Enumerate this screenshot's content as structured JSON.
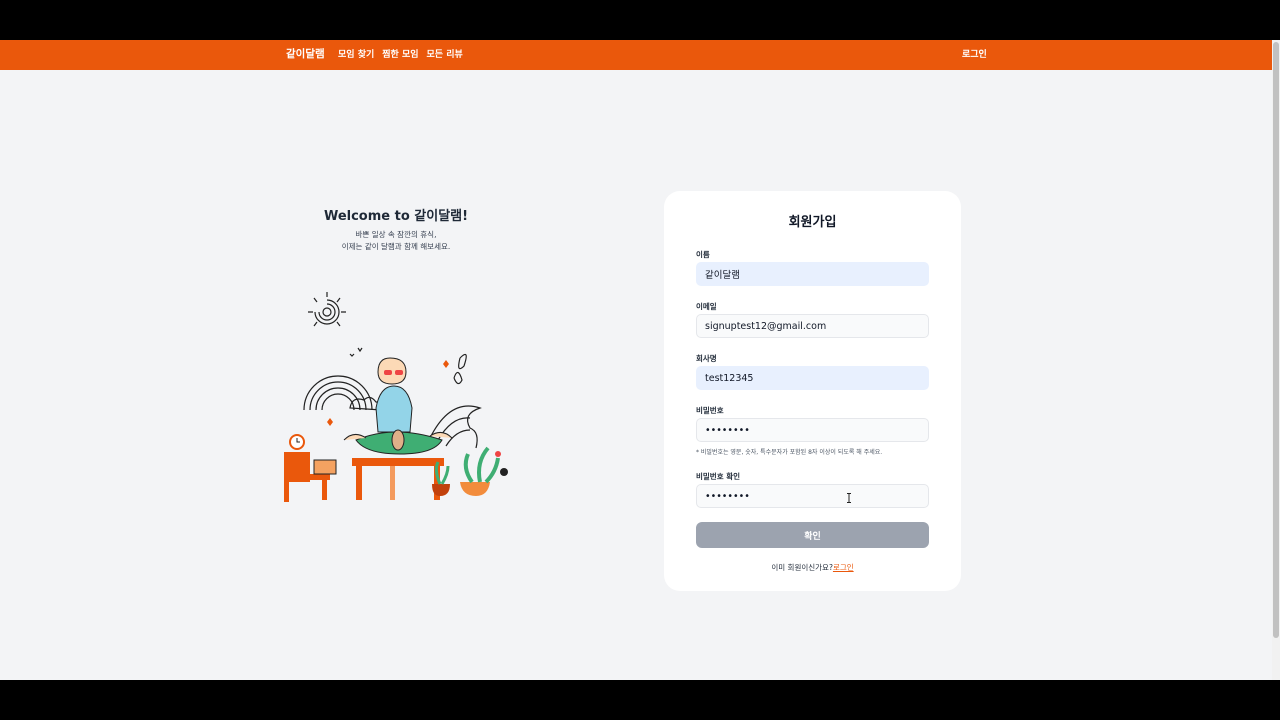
{
  "gnb": {
    "logo": "같이달램",
    "nav": [
      "모임 찾기",
      "찜한 모임",
      "모든 리뷰"
    ],
    "login": "로그인",
    "color": "#ea580c"
  },
  "welcome": {
    "title": "Welcome to 같이달램!",
    "line1": "바쁜 일상 속 잠깐의 휴식,",
    "line2": "이제는 같이 달램과 함께 해보세요."
  },
  "signup": {
    "title": "회원가입",
    "fields": [
      {
        "label": "이름",
        "value": "같이달램"
      },
      {
        "label": "이메일",
        "value": "signuptest12@gmail.com"
      },
      {
        "label": "회사명",
        "value": "test12345"
      },
      {
        "label": "비밀번호",
        "value": "••••••••"
      },
      {
        "label": "비밀번호 확인",
        "value": "••••••••"
      }
    ],
    "password_hint": "* 비밀번호는 영문, 숫자, 특수문자가 포함된 8자 이상이 되도록 해 주세요.",
    "submit": "확인",
    "footer_question": "이미 회원이신가요?",
    "footer_link": "로그인"
  }
}
